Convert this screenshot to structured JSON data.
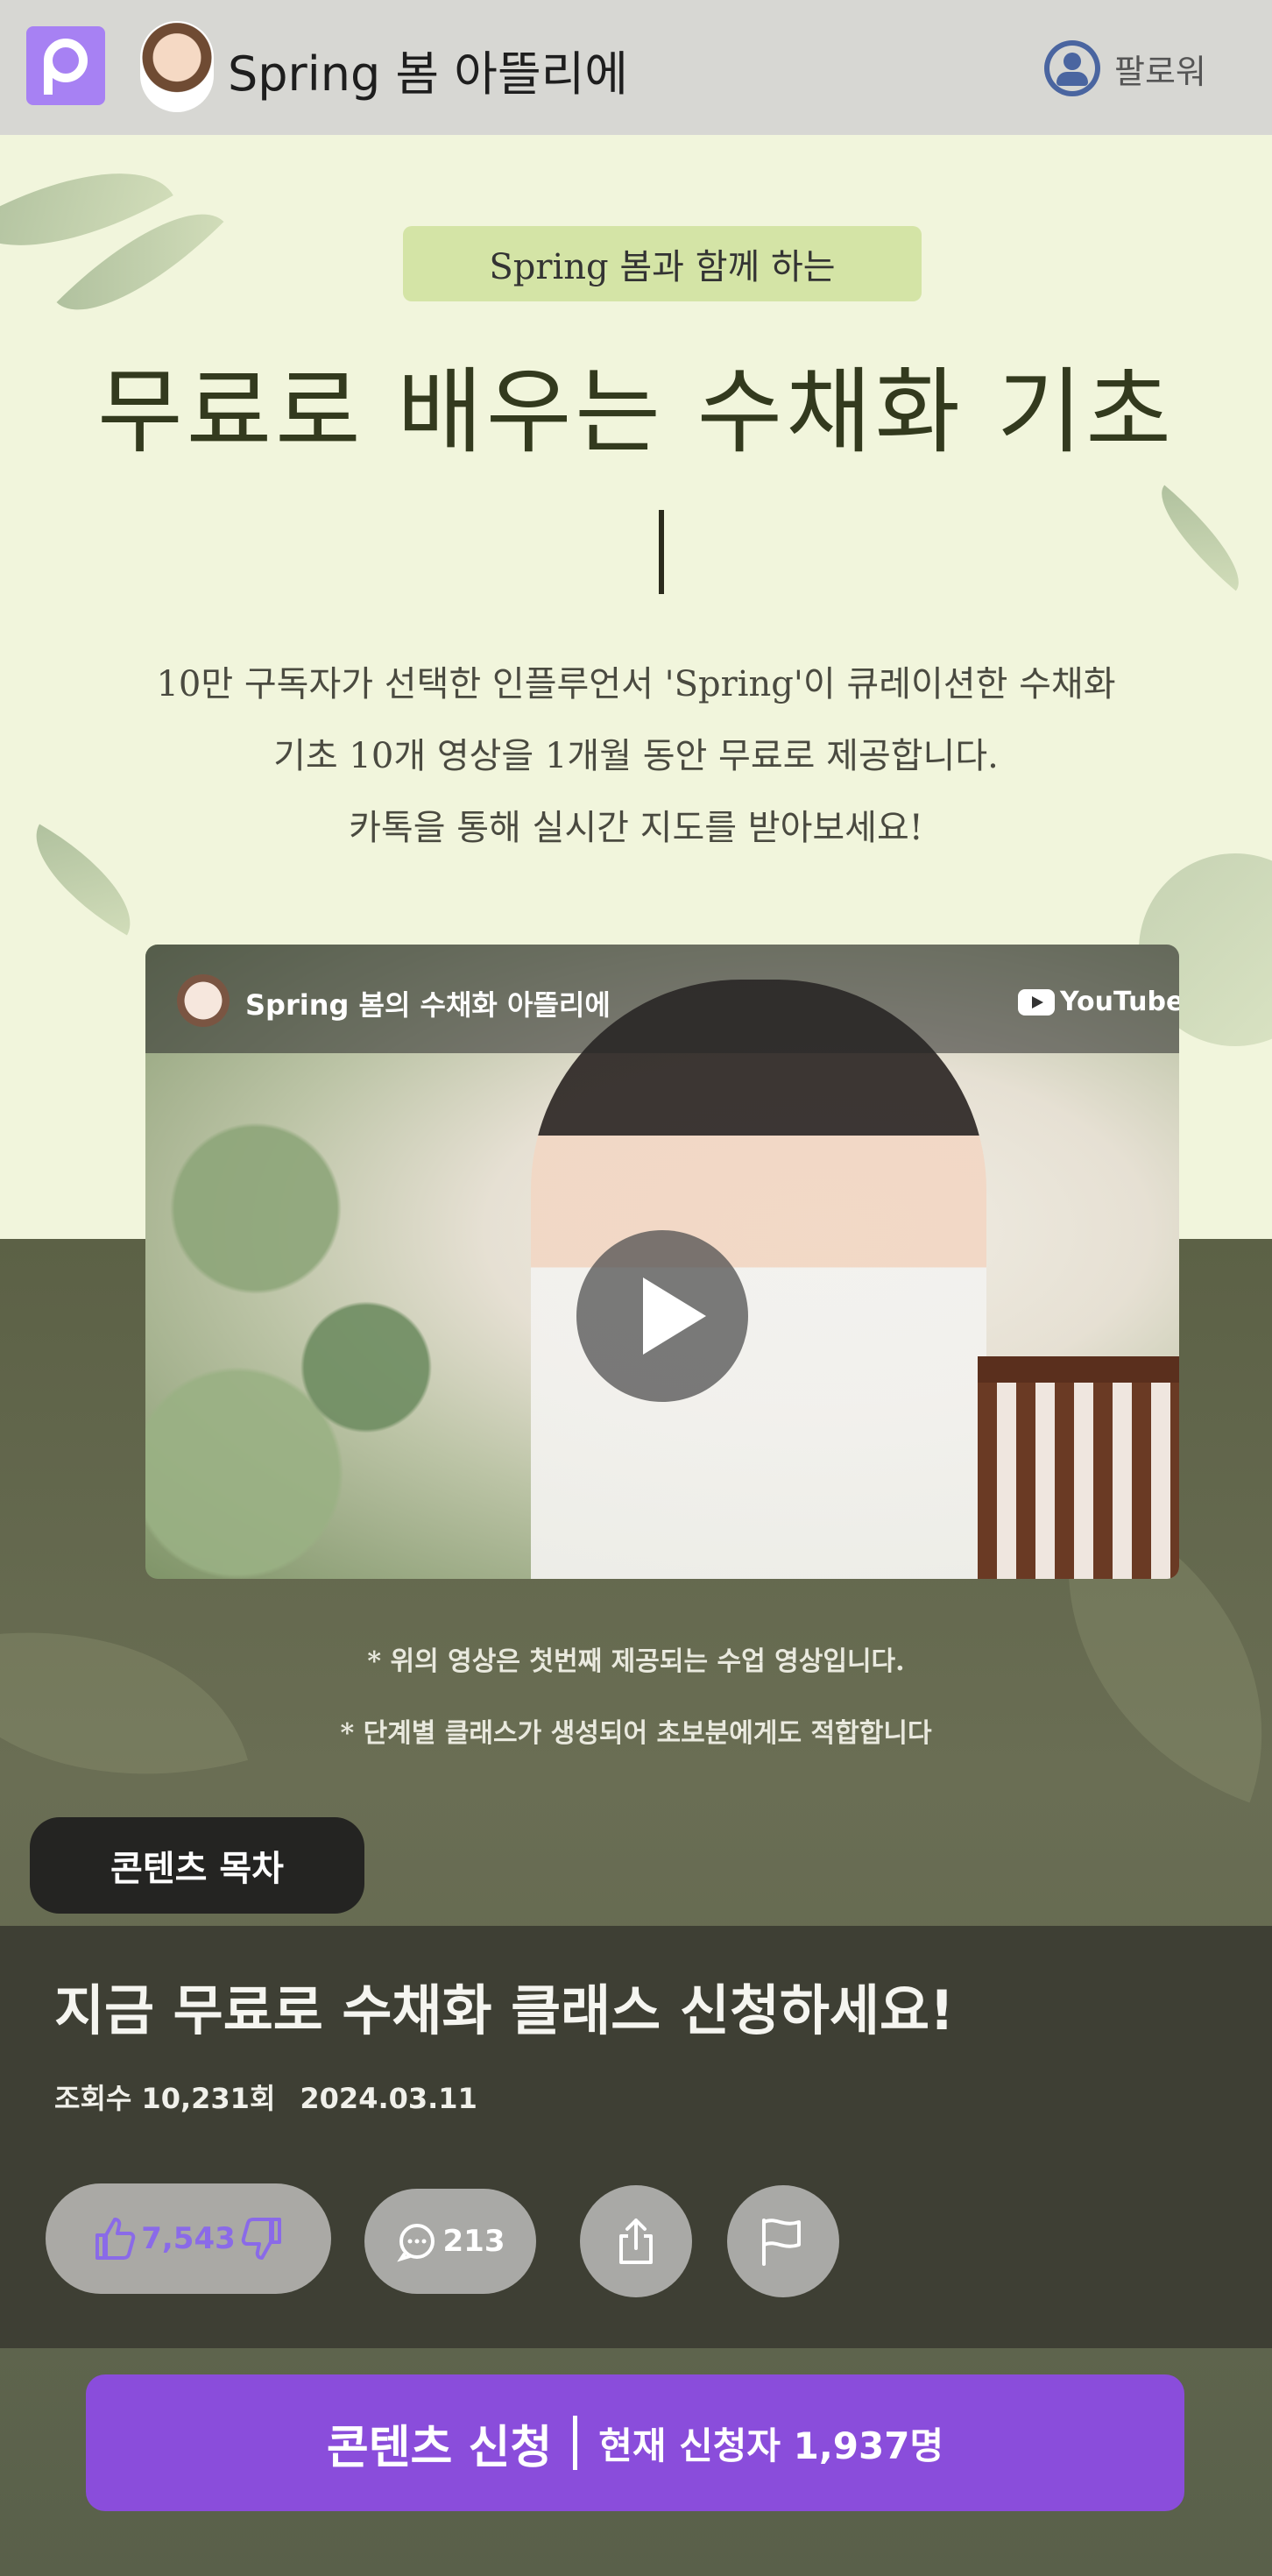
{
  "header": {
    "channel_name": "Spring 봄 아뜰리에",
    "follow_label": "팔로워"
  },
  "hero": {
    "badge": "Spring 봄과 함께 하는",
    "title": "무료로 배우는 수채화 기초",
    "description_lines": [
      "10만 구독자가 선택한 인플루언서 'Spring'이 큐레이션한 수채화",
      "기초 10개 영상을 1개월 동안 무료로 제공합니다.",
      "카톡을 통해 실시간 지도를 받아보세요!"
    ]
  },
  "video": {
    "channel_title": "Spring 봄의 수채화 아뜰리에",
    "platform_label": "YouTube",
    "notes": [
      "* 위의 영상은 첫번째 제공되는 수업 영상입니다.",
      "* 단계별 클래스가 생성되어 초보분에게도 적합합니다"
    ]
  },
  "toc": {
    "label": "콘텐츠 목차"
  },
  "post": {
    "title": "지금 무료로 수채화 클래스 신청하세요!",
    "views": "조회수 10,231회",
    "date": "2024.03.11",
    "likes": "7,543",
    "comments": "213"
  },
  "cta": {
    "main_label": "콘텐츠 신청",
    "sub_label": "현재 신청자 1,937명"
  },
  "colors": {
    "brand_purple": "#8a4ddb",
    "logo_purple": "#a781f3",
    "hero_bg": "#f1f5dc",
    "badge_bg": "#d4e4a6",
    "panel_dark": "#3e3f34"
  }
}
